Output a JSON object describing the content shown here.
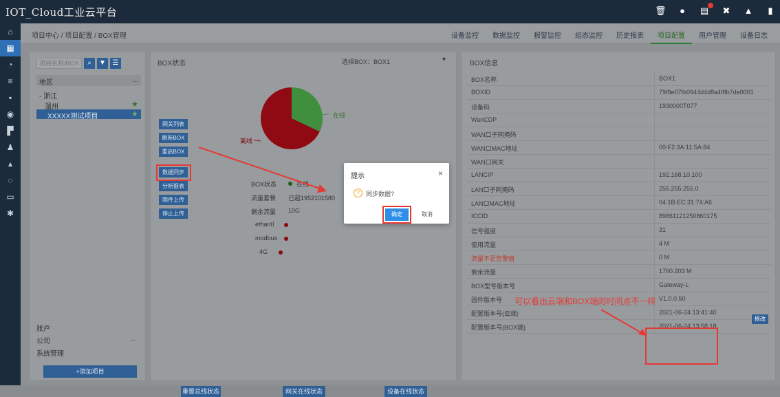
{
  "app": {
    "title": "IOT_Cloud工业云平台"
  },
  "topbar_icons": [
    "trash-icon",
    "help-icon",
    "message-icon",
    "close-icon",
    "user-icon",
    "logout-icon"
  ],
  "rail_icons": [
    "home-icon",
    "grid-icon",
    "alarm-icon",
    "list-icon",
    "device-icon",
    "settings-icon",
    "flag-icon",
    "user-icon",
    "person-icon",
    "cloud-icon",
    "storage-icon",
    "gear-icon"
  ],
  "breadcrumb": "项目中心 / 项目配置 / BOX管理",
  "nav_tabs": [
    "设备监控",
    "数据监控",
    "报警监控",
    "组态监控",
    "历史报表",
    "项目配置",
    "用户管理",
    "设备日志"
  ],
  "nav_active": "项目配置",
  "left": {
    "search_placeholder": "项目名称/BOX",
    "tree_header": "地区",
    "tree_header_more": "...",
    "tree": [
      {
        "label": "- 浙江"
      },
      {
        "label": "温州"
      },
      {
        "label": "XXXXX测试项目"
      }
    ],
    "footer": [
      {
        "label": "账户"
      },
      {
        "label": "公司",
        "more": "..."
      },
      {
        "label": "系统管理"
      }
    ],
    "add_button": "+添加项目"
  },
  "middle": {
    "title": "BOX状态",
    "box_select": "选择BOX：BOX1",
    "side_buttons": [
      "网关列表",
      "刷新BOX",
      "重启BOX",
      "数据同步",
      "分析报表",
      "固件上传",
      "停止上传"
    ],
    "pie_labels": {
      "online": "在线",
      "offline": "离线"
    },
    "status": [
      {
        "label": "BOX状态",
        "value": "在线",
        "color": "#1e5e1e"
      },
      {
        "label": "流量套餐",
        "value": "已超1952101580"
      },
      {
        "label": "剩余流量",
        "value": "10G"
      },
      {
        "label": "ethan0",
        "color": "#8b0a0a"
      },
      {
        "label": "modbus",
        "color": "#8b0a0a"
      },
      {
        "label": "4G",
        "color": "#8b0a0a"
      }
    ],
    "bottom_buttons": [
      "重置总线状态",
      "网关在线状态",
      "设备在线状态"
    ]
  },
  "right": {
    "title": "BOX信息",
    "rows": [
      {
        "k": "BOX名称",
        "v": "BOX1"
      },
      {
        "k": "BOXID",
        "v": "79f8e07fb0944d4d8a4f8b7de0001"
      },
      {
        "k": "设备码",
        "v": "1930000T077"
      },
      {
        "k": "WanCDP",
        "v": ""
      },
      {
        "k": "WAN口子网掩码",
        "v": ""
      },
      {
        "k": "WAN口MAC地址",
        "v": "00:F2:3A:11:5A:84"
      },
      {
        "k": "WAN口网关",
        "v": ""
      },
      {
        "k": "LANCIP",
        "v": "192.168.10.100"
      },
      {
        "k": "LAN口子网掩码",
        "v": "255.255.255.0"
      },
      {
        "k": "LAN口MAC地址",
        "v": "04:1B:EC:31:74:A6"
      },
      {
        "k": "ICCID",
        "v": "89861121250860175"
      },
      {
        "k": "信号强度",
        "v": "31"
      },
      {
        "k": "使用流量",
        "v": "4 M"
      },
      {
        "k": "流量不足告警值",
        "v": "0 M",
        "warn": true
      },
      {
        "k": "剩余流量",
        "v": "1760.203 M"
      },
      {
        "k": "BOX型号版本号",
        "v": "Gateway-L"
      },
      {
        "k": "固件版本号",
        "v": "V1.0.0.50"
      },
      {
        "k": "配置版本号(云端)",
        "v": "2021-06-24 13:41:40"
      },
      {
        "k": "配置版本号(BOX端)",
        "v": "2021-06-24 13:58:18"
      }
    ],
    "edit_button": "修改"
  },
  "annotation": "可以看出云端和BOX端的时间点不一样",
  "modal": {
    "title": "提示",
    "message": "同步数据?",
    "ok": "确定",
    "cancel": "取消",
    "close": "×"
  }
}
